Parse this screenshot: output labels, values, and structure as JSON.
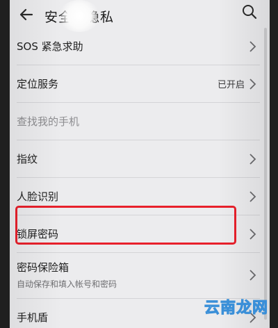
{
  "header": {
    "title": "安全和隐私",
    "back_icon": "arrow-left-icon",
    "search_icon": "search-icon"
  },
  "list": [
    {
      "label": "SOS 紧急求助"
    },
    {
      "label": "定位服务",
      "value": "已开启"
    },
    {
      "label": "查找我的手机",
      "disabled": true
    },
    {
      "label": "指纹"
    },
    {
      "label": "人脸识别"
    },
    {
      "label": "锁屏密码",
      "highlighted": true
    },
    {
      "label": "密码保险箱",
      "sublabel": "自动保存和填入帐号和密码"
    },
    {
      "label": "手机盾"
    }
  ],
  "annotation": {
    "highlight_color": "#e8202b"
  },
  "watermark": {
    "text": "云南龙网"
  }
}
